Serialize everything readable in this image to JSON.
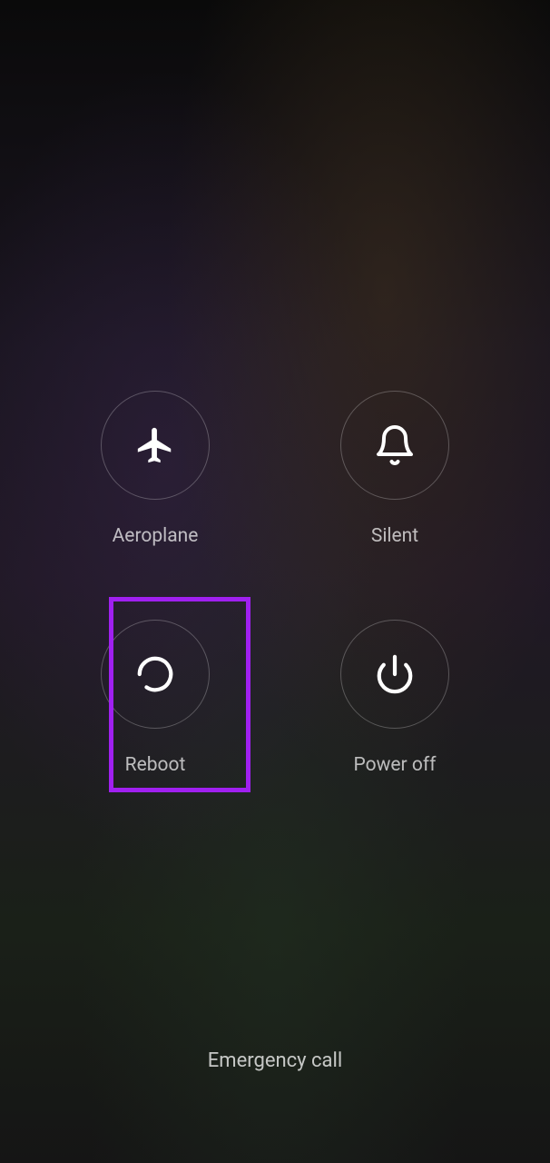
{
  "options": {
    "aeroplane": {
      "label": "Aeroplane"
    },
    "silent": {
      "label": "Silent"
    },
    "reboot": {
      "label": "Reboot"
    },
    "poweroff": {
      "label": "Power off"
    }
  },
  "emergency": {
    "label": "Emergency call"
  },
  "highlighted": "reboot"
}
